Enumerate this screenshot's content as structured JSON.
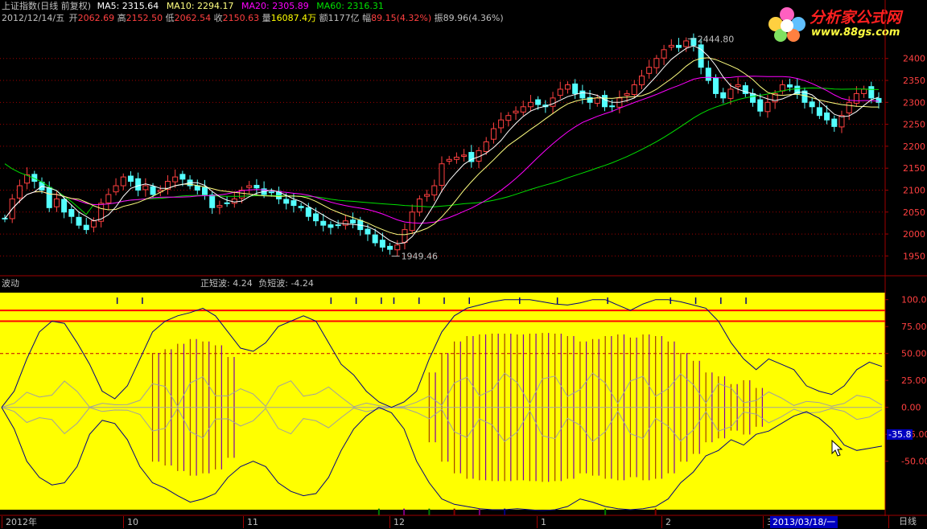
{
  "header": {
    "title": "上证指数(日线 前复权)",
    "ma5": "MA5: 2315.64",
    "ma10": "MA10: 2294.17",
    "ma20": "MA20: 2305.89",
    "ma60": "MA60: 2316.31",
    "date": "2012/12/14/五",
    "open_label": "开",
    "open": "2062.69",
    "high_label": "高",
    "high": "2152.50",
    "low_label": "低",
    "low": "2062.54",
    "close_label": "收",
    "close": "2150.63",
    "volume_label": "量",
    "volume": "16087.4万",
    "amount_label": "额",
    "amount": "1177亿",
    "range_label": "幅",
    "range": "89.15(4.32%)",
    "amplitude_label": "振",
    "amplitude": "89.96(4.36%)"
  },
  "logo": {
    "name": "分析家公式网",
    "url": "www.88gs.com"
  },
  "indicator": {
    "name": "波动",
    "pos_label": "正短波:",
    "pos_value": "4.24",
    "neg_label": "负短波:",
    "neg_value": "-4.24",
    "current_value": "-35.8"
  },
  "price_axis": [
    "2400",
    "2350",
    "2300",
    "2250",
    "2200",
    "2150",
    "2100",
    "2050",
    "2000",
    "1950"
  ],
  "indicator_axis": [
    "100.0",
    "75.00",
    "50.00",
    "25.00",
    "0.00",
    "-25.00",
    "-50.00"
  ],
  "annotations": {
    "high_mark": "2444.80",
    "low_mark": "1949.46"
  },
  "time_axis": [
    {
      "label": "2012年"
    },
    {
      "label": "10"
    },
    {
      "label": "11"
    },
    {
      "label": "12"
    },
    {
      "label": "1"
    },
    {
      "label": "2"
    },
    {
      "label": "3"
    }
  ],
  "cursor_date": "2013/03/18/一",
  "period_button": "日线",
  "colors": {
    "up": "#ff4040",
    "down": "#54ffff",
    "ma5": "#ffffff",
    "ma10": "#ffff80",
    "ma20": "#ff00ff",
    "ma60": "#00e000",
    "panel_bg": "#ffff00",
    "grid": "#a00000"
  },
  "chart_data": [
    {
      "type": "candlestick",
      "title": "上证指数(日线 前复权)",
      "ylim": [
        1925,
        2460
      ],
      "series": [
        {
          "name": "MA5",
          "last": 2315.64
        },
        {
          "name": "MA10",
          "last": 2294.17
        },
        {
          "name": "MA20",
          "last": 2305.89
        },
        {
          "name": "MA60",
          "last": 2316.31
        }
      ],
      "close": [
        2035,
        2080,
        2110,
        2135,
        2120,
        2100,
        2060,
        2080,
        2050,
        2040,
        2020,
        2010,
        2030,
        2070,
        2090,
        2110,
        2130,
        2120,
        2100,
        2110,
        2090,
        2100,
        2120,
        2130,
        2125,
        2110,
        2100,
        2090,
        2060,
        2065,
        2070,
        2080,
        2100,
        2110,
        2105,
        2090,
        2095,
        2080,
        2070,
        2065,
        2060,
        2040,
        2030,
        2020,
        2015,
        2020,
        2030,
        2025,
        2010,
        2000,
        1980,
        1970,
        1965,
        1975,
        2010,
        2050,
        2080,
        2090,
        2110,
        2160,
        2170,
        2175,
        2180,
        2165,
        2190,
        2210,
        2240,
        2260,
        2270,
        2280,
        2290,
        2300,
        2295,
        2290,
        2310,
        2330,
        2340,
        2320,
        2310,
        2300,
        2310,
        2290,
        2290,
        2310,
        2320,
        2340,
        2360,
        2380,
        2400,
        2420,
        2430,
        2425,
        2440,
        2430,
        2380,
        2350,
        2320,
        2310,
        2330,
        2340,
        2320,
        2300,
        2280,
        2300,
        2320,
        2340,
        2335,
        2320,
        2300,
        2290,
        2270,
        2260,
        2245,
        2270,
        2300,
        2320,
        2330,
        2310,
        2300
      ],
      "annotations": [
        "2444.80",
        "1949.46"
      ]
    },
    {
      "type": "line",
      "title": "波动",
      "ylim": [
        -95,
        105
      ],
      "series": [
        {
          "name": "upper",
          "values": [
            0,
            15,
            45,
            70,
            80,
            78,
            60,
            40,
            15,
            8,
            20,
            45,
            70,
            80,
            85,
            88,
            92,
            85,
            70,
            55,
            52,
            60,
            75,
            80,
            85,
            80,
            60,
            40,
            30,
            15,
            5,
            0,
            5,
            15,
            45,
            70,
            85,
            92,
            95,
            98,
            100,
            100,
            100,
            98,
            96,
            95,
            97,
            100,
            100,
            95,
            90,
            96,
            100,
            100,
            98,
            95,
            92,
            80,
            60,
            45,
            35,
            45,
            40,
            35,
            20,
            15,
            12,
            20,
            35,
            42,
            38
          ]
        },
        {
          "name": "lower",
          "values": [
            0,
            -20,
            -50,
            -65,
            -72,
            -70,
            -55,
            -25,
            -12,
            -15,
            -30,
            -55,
            -70,
            -75,
            -82,
            -88,
            -85,
            -80,
            -65,
            -55,
            -50,
            -55,
            -70,
            -78,
            -82,
            -80,
            -65,
            -40,
            -20,
            -8,
            0,
            -5,
            -20,
            -50,
            -70,
            -85,
            -90,
            -92,
            -94,
            -95,
            -95,
            -94,
            -95,
            -96,
            -95,
            -92,
            -85,
            -88,
            -92,
            -94,
            -95,
            -94,
            -92,
            -85,
            -70,
            -60,
            -45,
            -40,
            -30,
            -35,
            -25,
            -22,
            -15,
            -8,
            -4,
            -10,
            -20,
            -35,
            -40,
            -38,
            -36
          ]
        },
        {
          "name": "正短波",
          "last": 4.24
        },
        {
          "name": "负短波",
          "last": -4.24
        }
      ],
      "reference_lines": [
        90,
        80,
        50
      ]
    }
  ]
}
